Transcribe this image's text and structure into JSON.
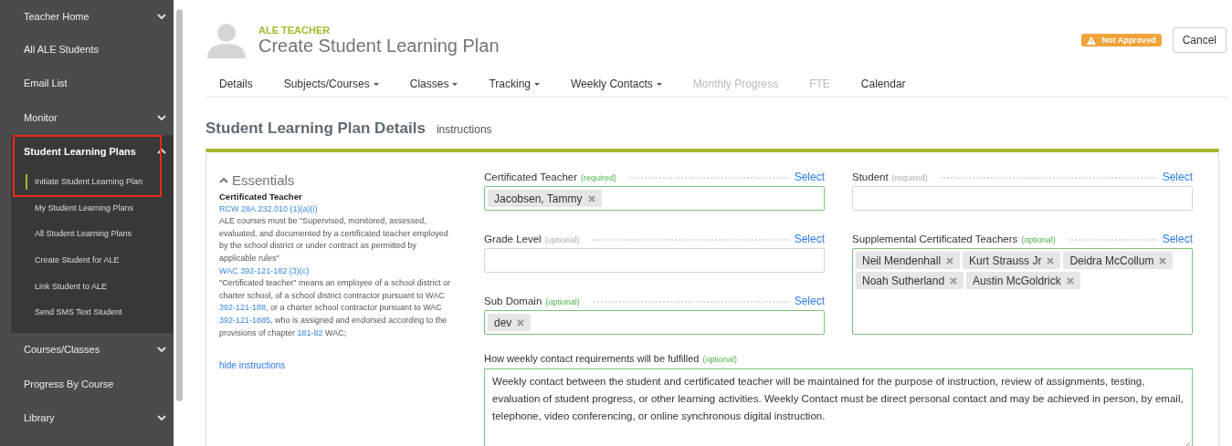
{
  "sidebar": {
    "items": [
      {
        "label": "Teacher Home",
        "has_caret": true,
        "expanded": false,
        "highlighted": false
      },
      {
        "label": "All ALE Students",
        "has_caret": false,
        "expanded": false,
        "highlighted": false
      },
      {
        "label": "Email List",
        "has_caret": false,
        "expanded": false,
        "highlighted": false
      },
      {
        "label": "Monitor",
        "has_caret": true,
        "expanded": false,
        "highlighted": false
      },
      {
        "label": "Student Learning Plans",
        "has_caret": true,
        "expanded": true,
        "highlighted": true,
        "children": [
          {
            "label": "Initiate Student Learning Plan",
            "selected": true
          },
          {
            "label": "My Student Learning Plans",
            "selected": false
          },
          {
            "label": "All Student Learning Plans",
            "selected": false
          },
          {
            "label": "Create Student for ALE",
            "selected": false
          },
          {
            "label": "Link Student to ALE",
            "selected": false
          },
          {
            "label": "Send SMS Text Student",
            "selected": false
          }
        ]
      },
      {
        "label": "Courses/Classes",
        "has_caret": true,
        "expanded": false,
        "highlighted": false
      },
      {
        "label": "Progress By Course",
        "has_caret": false,
        "expanded": false,
        "highlighted": false
      },
      {
        "label": "Library",
        "has_caret": true,
        "expanded": false,
        "highlighted": false
      }
    ]
  },
  "header": {
    "role": "ALE TEACHER",
    "title": "Create Student Learning Plan",
    "status_badge": "Not Approved",
    "cancel_button": "Cancel"
  },
  "tabs": [
    {
      "label": "Details",
      "dropdown": false,
      "disabled": false
    },
    {
      "label": "Subjects/Courses",
      "dropdown": true,
      "disabled": false
    },
    {
      "label": "Classes",
      "dropdown": true,
      "disabled": false
    },
    {
      "label": "Tracking",
      "dropdown": true,
      "disabled": false
    },
    {
      "label": "Weekly Contacts",
      "dropdown": true,
      "disabled": false
    },
    {
      "label": "Monthly Progress",
      "dropdown": false,
      "disabled": true
    },
    {
      "label": "FTE",
      "dropdown": false,
      "disabled": true
    },
    {
      "label": "Calendar",
      "dropdown": false,
      "disabled": false
    }
  ],
  "section": {
    "title": "Student Learning Plan Details",
    "instructions_link": "instructions"
  },
  "instructions": {
    "heading": "Essentials",
    "subheading": "Certificated Teacher",
    "blocks": [
      {
        "kind": "link",
        "segments": [
          {
            "text": "RCW 28A.232.010 (1)(a)(i)",
            "link": true
          }
        ]
      },
      {
        "kind": "paragraph",
        "segments": [
          {
            "text": "ALE courses must be \"Supervised, monitored, assessed, evaluated, and documented by a certificated teacher employed by the school district or under contract as permitted by applicable rules\"",
            "link": false
          }
        ]
      },
      {
        "kind": "link",
        "segments": [
          {
            "text": "WAC 392-121-182 (3)(c)",
            "link": true
          }
        ]
      },
      {
        "kind": "paragraph",
        "segments": [
          {
            "text": "\"Certificated teacher\" means an employee of a school district or charter school, of a school district contractor pursuant to WAC ",
            "link": false
          },
          {
            "text": "392-121-188",
            "link": true
          },
          {
            "text": ", or a charter school contractor pursuant to WAC ",
            "link": false
          },
          {
            "text": "392-121-1885",
            "link": true
          },
          {
            "text": ", who is assigned and endorsed according to the provisions of chapter ",
            "link": false
          },
          {
            "text": "181-82",
            "link": true
          },
          {
            "text": " WAC;",
            "link": false
          }
        ]
      }
    ],
    "hide_link": "hide instructions"
  },
  "left_fields": [
    {
      "label": "Certificated Teacher",
      "requirement": "(required)",
      "valid": true,
      "select": "Select",
      "tags": [
        "Jacobsen, Tammy"
      ]
    },
    {
      "label": "Grade Level",
      "requirement": "(optional)",
      "valid": false,
      "select": "Select"
    },
    {
      "label": "Sub Domain",
      "requirement": "(optional)",
      "valid": true,
      "select": "Select",
      "tags": [
        "dev"
      ]
    }
  ],
  "right_fields": [
    {
      "label": "Student",
      "requirement": "(required)",
      "valid": false,
      "select": "Select"
    },
    {
      "label": "Supplemental Certificated Teachers",
      "requirement": "(optional)",
      "valid": true,
      "select": "Select",
      "tags": [
        "Neil Mendenhall",
        "Kurt Strauss Jr",
        "Deidra McCollum",
        "Noah Sutherland",
        "Austin McGoldrick"
      ]
    }
  ],
  "weekly_contact": {
    "label": "How weekly contact requirements will be fulfilled",
    "requirement": "(optional)",
    "valid": true,
    "value": "Weekly contact between the student and certificated teacher will be maintained for the purpose of instruction, review of assignments, testing, evaluation of student progress, or other learning activities. Weekly Contact must be direct personal contact and may be achieved in person, by email, telephone, video conferencing, or online synchronous digital instruction."
  }
}
